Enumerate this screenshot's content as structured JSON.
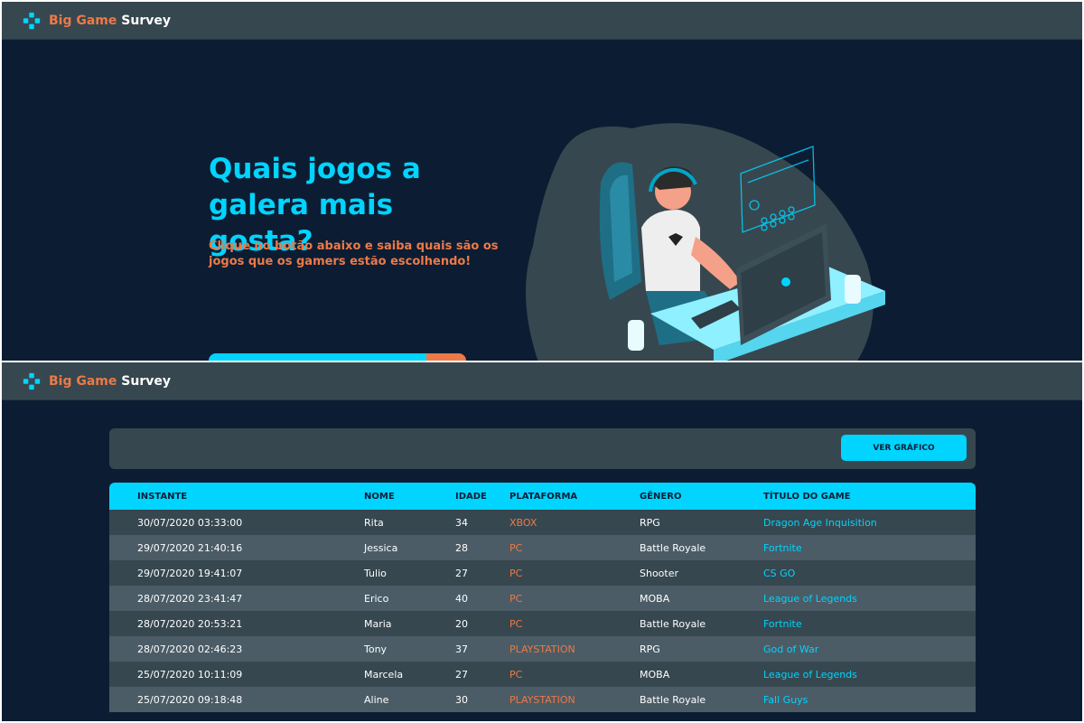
{
  "brand": {
    "part1": "Big Game",
    "part2": "Survey",
    "icon": "gamepad-icon"
  },
  "hero": {
    "title": "Quais jogos a galera mais gosta?",
    "subtitle": "Clique no botão abaixo e saiba quais são os jogos que os gamers estão escolhendo!",
    "illustration": "gamer-illustration"
  },
  "records": {
    "chart_button": "VER GRÁFICO",
    "columns": [
      "INSTANTE",
      "NOME",
      "IDADE",
      "PLATAFORMA",
      "GÊNERO",
      "TÍTULO DO GAME"
    ],
    "rows": [
      [
        "30/07/2020 03:33:00",
        "Rita",
        "34",
        "XBOX",
        "RPG",
        "Dragon Age Inquisition"
      ],
      [
        "29/07/2020 21:40:16",
        "Jessica",
        "28",
        "PC",
        "Battle Royale",
        "Fortnite"
      ],
      [
        "29/07/2020 19:41:07",
        "Tulio",
        "27",
        "PC",
        "Shooter",
        "CS GO"
      ],
      [
        "28/07/2020 23:41:47",
        "Erico",
        "40",
        "PC",
        "MOBA",
        "League of Legends"
      ],
      [
        "28/07/2020 20:53:21",
        "Maria",
        "20",
        "PC",
        "Battle Royale",
        "Fortnite"
      ],
      [
        "28/07/2020 02:46:23",
        "Tony",
        "37",
        "PLAYSTATION",
        "RPG",
        "God of War"
      ],
      [
        "25/07/2020 10:11:09",
        "Marcela",
        "27",
        "PC",
        "MOBA",
        "League of Legends"
      ],
      [
        "25/07/2020 09:18:48",
        "Aline",
        "30",
        "PLAYSTATION",
        "Battle Royale",
        "Fall Guys"
      ]
    ]
  },
  "colors": {
    "primary": "#00d4ff",
    "accent": "#ed7947",
    "background": "#0c1d33",
    "surface": "#37474f"
  }
}
